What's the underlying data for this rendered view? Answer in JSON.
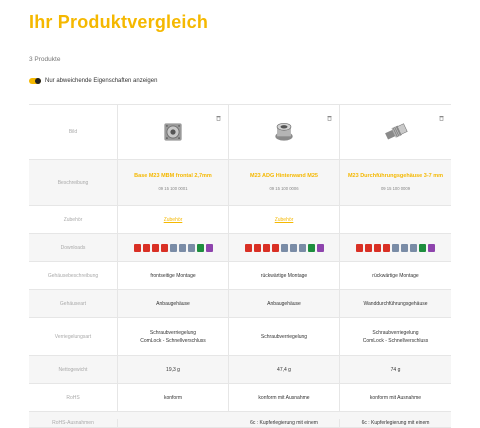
{
  "header": {
    "title": "Ihr Produktvergleich",
    "count": "3 Produkte",
    "toggle_label": "Nur abweichende Eigenschaften anzeigen"
  },
  "products": [
    {
      "name": "Base M23 MBM frontal 2,7mm",
      "number": "09 15 100 0001",
      "zubehoer": "Zubehör",
      "downloads": [
        "pdf",
        "pdf",
        "pdf",
        "pdf",
        "cad",
        "cad",
        "cad",
        "xls",
        "zip"
      ],
      "gehaeusebeschreibung": "frontseitige Montage",
      "gehaeuseart": "Anbaugehäuse",
      "verriegelung": [
        "Schraubverriegelung",
        "ComLock - Schnellverschluss"
      ],
      "nettogewicht": "19,3 g",
      "rohs": "konform",
      "ausnahme": ""
    },
    {
      "name": "M23 ADG Hinterwand M25",
      "number": "09 15 100 0006",
      "zubehoer": "Zubehör",
      "downloads": [
        "pdf",
        "pdf",
        "pdf",
        "pdf",
        "cad",
        "cad",
        "cad",
        "xls",
        "zip"
      ],
      "gehaeusebeschreibung": "rückwärtige Montage",
      "gehaeuseart": "Anbaugehäuse",
      "verriegelung": [
        "Schraubverriegelung"
      ],
      "nettogewicht": "47,4 g",
      "rohs": "konform mit Ausnahme",
      "ausnahme": "6c : Kupferlegierung mit einem"
    },
    {
      "name": "M23 Durchführungsgehäuse 3-7 mm",
      "number": "09 15 100 0009",
      "zubehoer": "",
      "downloads": [
        "pdf",
        "pdf",
        "pdf",
        "pdf",
        "cad",
        "cad",
        "cad",
        "xls",
        "zip"
      ],
      "gehaeusebeschreibung": "rückwärtige Montage",
      "gehaeuseart": "Wanddurchführungsgehäuse",
      "verriegelung": [
        "Schraubverriegelung",
        "ComLock - Schnellverschluss"
      ],
      "nettogewicht": "74 g",
      "rohs": "konform mit Ausnahme",
      "ausnahme": "6c : Kupferlegierung mit einem"
    }
  ],
  "rows": {
    "bild": "Bild",
    "beschreibung": "Beschreibung",
    "zubehoer": "Zubehör",
    "downloads": "Downloads",
    "gehaeusebeschreibung": "Gehäusebeschreibung",
    "gehaeuseart": "Gehäuseart",
    "verriegelung": "Verriegelungsart",
    "nettogewicht": "Nettogewicht",
    "rohs": "RoHS",
    "ausnahme": "RoHS-Ausnahmen"
  },
  "colors": {
    "accent": "#f5b800",
    "pdf": "#d93025",
    "cad": "#7a8ca6",
    "xls": "#1e8e3e",
    "zip": "#8e44ad"
  },
  "icons": [
    "trash-icon",
    "pdf-file-icon",
    "cad-file-icon",
    "excel-file-icon",
    "zip-file-icon"
  ]
}
